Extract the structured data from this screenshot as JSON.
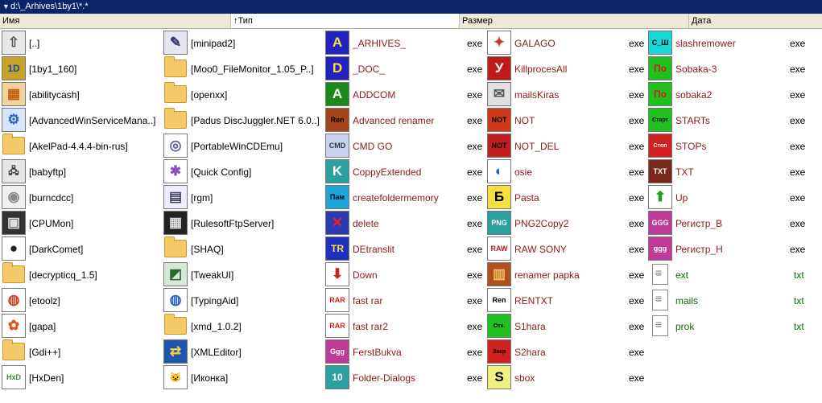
{
  "path": "d:\\_Arhives\\1by1\\*.*",
  "columns": {
    "name": "Имя",
    "type": "Тип",
    "size": "Размер",
    "date": "Дата"
  },
  "col1": [
    {
      "name": "[..]",
      "icon": "up-arrow-icon",
      "glyph": "⇧",
      "bg": "#e8e8e8",
      "fg": "#555"
    },
    {
      "name": "[1by1_160]",
      "icon": "app-1by1-icon",
      "glyph": "1D",
      "bg": "#c7a227",
      "fg": "#1a4aa0"
    },
    {
      "name": "[abilitycash]",
      "icon": "abilitycash-icon",
      "glyph": "▦",
      "bg": "#f4d29c",
      "fg": "#c06010"
    },
    {
      "name": "[AdvancedWinServiceMana..]",
      "icon": "service-gears-icon",
      "glyph": "⚙",
      "bg": "#d8e6fb",
      "fg": "#2a62c9"
    },
    {
      "name": "[AkelPad-4.4.4-bin-rus]",
      "icon": "folder-icon",
      "glyph": "",
      "bg": "folder",
      "fg": ""
    },
    {
      "name": "[babyftp]",
      "icon": "network-computers-icon",
      "glyph": "🖧",
      "bg": "#e6e6e6",
      "fg": "#333"
    },
    {
      "name": "[burncdcc]",
      "icon": "cd-disc-icon",
      "glyph": "◉",
      "bg": "#f0f0f0",
      "fg": "#888"
    },
    {
      "name": "[CPUMon]",
      "icon": "cpu-chip-icon",
      "glyph": "▣",
      "bg": "#333",
      "fg": "#ddd"
    },
    {
      "name": "[DarkComet]",
      "icon": "darkcomet-icon",
      "glyph": "●",
      "bg": "#fff",
      "fg": "#222"
    },
    {
      "name": "[decrypticq_1.5]",
      "icon": "folder-icon",
      "glyph": "",
      "bg": "folder",
      "fg": ""
    },
    {
      "name": "[etoolz]",
      "icon": "etoolz-globe-icon",
      "glyph": "◍",
      "bg": "#fff",
      "fg": "#d04020"
    },
    {
      "name": "[gapa]",
      "icon": "butterfly-icon",
      "glyph": "✿",
      "bg": "#fff",
      "fg": "#e05020"
    },
    {
      "name": "[Gdi++]",
      "icon": "folder-icon",
      "glyph": "",
      "bg": "folder",
      "fg": ""
    },
    {
      "name": "[HxDen]",
      "icon": "hxd-icon",
      "glyph": "HxD",
      "bg": "#fff",
      "fg": "#3a8a3a"
    }
  ],
  "col2": [
    {
      "name": "[minipad2]",
      "icon": "notepad-pen-icon",
      "glyph": "✎",
      "bg": "#e6e6f0",
      "fg": "#336"
    },
    {
      "name": "[Moo0_FileMonitor_1.05_P..]",
      "icon": "folder-icon",
      "glyph": "",
      "bg": "folder",
      "fg": ""
    },
    {
      "name": "[openxx]",
      "icon": "folder-icon",
      "glyph": "",
      "bg": "folder",
      "fg": ""
    },
    {
      "name": "[Padus DiscJuggler.NET 6.0..]",
      "icon": "folder-icon",
      "glyph": "",
      "bg": "folder",
      "fg": ""
    },
    {
      "name": "[PortableWinCDEmu]",
      "icon": "cd-emu-icon",
      "glyph": "◎",
      "bg": "#fff",
      "fg": "#5a5aa0"
    },
    {
      "name": "[Quick Config]",
      "icon": "quick-config-icon",
      "glyph": "✱",
      "bg": "#fff",
      "fg": "#8a50c0"
    },
    {
      "name": "[rgm]",
      "icon": "rgm-icon",
      "glyph": "▤",
      "bg": "#eef",
      "fg": "#446"
    },
    {
      "name": "[RulesoftFtpServer]",
      "icon": "ftp-server-icon",
      "glyph": "▦",
      "bg": "#222",
      "fg": "#ddd"
    },
    {
      "name": "[SHAQ]",
      "icon": "folder-icon",
      "glyph": "",
      "bg": "folder",
      "fg": ""
    },
    {
      "name": "[TweakUI]",
      "icon": "tweakui-icon",
      "glyph": "◩",
      "bg": "#d8e8d8",
      "fg": "#2a6a2a"
    },
    {
      "name": "[TypingAid]",
      "icon": "typingaid-globe-icon",
      "glyph": "◍",
      "bg": "#fff",
      "fg": "#2060c0"
    },
    {
      "name": "[xmd_1.0.2]",
      "icon": "folder-icon",
      "glyph": "",
      "bg": "folder",
      "fg": ""
    },
    {
      "name": "[XMLEditor]",
      "icon": "xml-editor-icon",
      "glyph": "⇄",
      "bg": "#1f56b0",
      "fg": "#f5d23a"
    },
    {
      "name": "[Иконка]",
      "icon": "cat-icon",
      "glyph": "😺",
      "bg": "#fff",
      "fg": "#333"
    }
  ],
  "col3": [
    {
      "name": "_ARHIVES_",
      "ext": "exe",
      "icon": "letter-a-icon",
      "glyph": "A",
      "bg": "#2222c0",
      "fg": "#f5e040"
    },
    {
      "name": "_DOC_",
      "ext": "exe",
      "icon": "letter-d-icon",
      "glyph": "D",
      "bg": "#2222c0",
      "fg": "#f5e040"
    },
    {
      "name": "ADDCOM",
      "ext": "exe",
      "icon": "addcom-icon",
      "glyph": "A",
      "bg": "#1a8a1a",
      "fg": "#fff"
    },
    {
      "name": "Advanced renamer",
      "ext": "exe",
      "icon": "ren-icon",
      "glyph": "Ren",
      "bg": "#a5431a",
      "fg": "#000"
    },
    {
      "name": "CMD GO",
      "ext": "exe",
      "icon": "cmd-icon",
      "glyph": "CMD",
      "bg": "#c8d2f0",
      "fg": "#334"
    },
    {
      "name": "CoppyExtended",
      "ext": "exe",
      "icon": "letter-k-icon",
      "glyph": "K",
      "bg": "#2aa0a0",
      "fg": "#fff"
    },
    {
      "name": "createfoldermemory",
      "ext": "exe",
      "icon": "folder-memory-icon",
      "glyph": "Пам",
      "bg": "#1aa6d6",
      "fg": "#002"
    },
    {
      "name": "delete",
      "ext": "exe",
      "icon": "delete-x-icon",
      "glyph": "✕",
      "bg": "#2a3ab0",
      "fg": "#f02020"
    },
    {
      "name": "DEtranslit",
      "ext": "exe",
      "icon": "tr-icon",
      "glyph": "TR",
      "bg": "#2030c0",
      "fg": "#f5e040"
    },
    {
      "name": "Down",
      "ext": "exe",
      "icon": "down-arrow-icon",
      "glyph": "⬇",
      "bg": "#fff",
      "fg": "#d02020"
    },
    {
      "name": "fast rar",
      "ext": "exe",
      "icon": "rar-icon",
      "glyph": "RAR",
      "bg": "#fff",
      "fg": "#d02020"
    },
    {
      "name": "fast rar2",
      "ext": "exe",
      "icon": "rar-slash-icon",
      "glyph": "RAR",
      "bg": "#fff",
      "fg": "#d02020"
    },
    {
      "name": "FerstBukva",
      "ext": "exe",
      "icon": "ggg-icon",
      "glyph": "Ggg",
      "bg": "#c03a9a",
      "fg": "#fff"
    },
    {
      "name": "Folder-Dialogs",
      "ext": "exe",
      "icon": "number-10-icon",
      "glyph": "10",
      "bg": "#2aa0a0",
      "fg": "#fff"
    }
  ],
  "col4": [
    {
      "name": "GALAGO",
      "ext": "exe",
      "icon": "galago-chest-icon",
      "glyph": "✦",
      "bg": "#fff",
      "fg": "#c83a1a"
    },
    {
      "name": "KillprocesAll",
      "ext": "exe",
      "icon": "letter-u-icon",
      "glyph": "У",
      "bg": "#c01a1a",
      "fg": "#fff"
    },
    {
      "name": "mailsKiras",
      "ext": "exe",
      "icon": "envelope-icon",
      "glyph": "✉",
      "bg": "#e0e0e0",
      "fg": "#555"
    },
    {
      "name": "NOT",
      "ext": "exe",
      "icon": "not-icon",
      "glyph": "NOT",
      "bg": "#d03a1a",
      "fg": "#000"
    },
    {
      "name": "NOT_DEL",
      "ext": "exe",
      "icon": "not-del-icon",
      "glyph": "NOT",
      "bg": "#c02020",
      "fg": "#000"
    },
    {
      "name": "osie",
      "ext": "exe",
      "icon": "osie-folder-icon",
      "glyph": "◐",
      "bg": "#fff",
      "fg": "#2060c0"
    },
    {
      "name": "Pasta",
      "ext": "exe",
      "icon": "letter-b-shield-icon",
      "glyph": "Б",
      "bg": "#f5e040",
      "fg": "#000"
    },
    {
      "name": "PNG2Copy2",
      "ext": "exe",
      "icon": "png-icon",
      "glyph": "PNG",
      "bg": "#2aa0a0",
      "fg": "#fff"
    },
    {
      "name": "RAW SONY",
      "ext": "exe",
      "icon": "raw-arw-icon",
      "glyph": "RAW",
      "bg": "#fff",
      "fg": "#b02020"
    },
    {
      "name": "renamer papka",
      "ext": "exe",
      "icon": "renamer-folder-icon",
      "glyph": "▥",
      "bg": "#b05020",
      "fg": "#f0c060"
    },
    {
      "name": "RENTXT",
      "ext": "exe",
      "icon": "ren-txt-icon",
      "glyph": "Ren",
      "bg": "#fff",
      "fg": "#000"
    },
    {
      "name": "S1hara",
      "ext": "exe",
      "icon": "otk-icon",
      "glyph": "Отк.",
      "bg": "#20c020",
      "fg": "#000"
    },
    {
      "name": "S2hara",
      "ext": "exe",
      "icon": "zakr-icon",
      "glyph": "Закр",
      "bg": "#d02020",
      "fg": "#000"
    },
    {
      "name": "sbox",
      "ext": "exe",
      "icon": "s-box-icon",
      "glyph": "S",
      "bg": "#f0f080",
      "fg": "#000"
    }
  ],
  "col5": [
    {
      "name": "slashremower",
      "ext": "exe",
      "icon": "c-sh-icon",
      "glyph": "C_Ш",
      "bg": "#1ad6d6",
      "fg": "#000"
    },
    {
      "name": "Sobaka-3",
      "ext": "exe",
      "icon": "pochta-icon",
      "glyph": "По",
      "bg": "#20c020",
      "fg": "#d02020"
    },
    {
      "name": "sobaka2",
      "ext": "exe",
      "icon": "pochta-icon",
      "glyph": "По",
      "bg": "#20c020",
      "fg": "#d02020"
    },
    {
      "name": "STARTs",
      "ext": "exe",
      "icon": "start-service-icon",
      "glyph": "Старт",
      "bg": "#20c020",
      "fg": "#000"
    },
    {
      "name": "STOPs",
      "ext": "exe",
      "icon": "stop-service-icon",
      "glyph": "Стоп",
      "bg": "#d02020",
      "fg": "#fff"
    },
    {
      "name": "TXT",
      "ext": "exe",
      "icon": "txt-icon",
      "glyph": "TXT",
      "bg": "#7a2a1a",
      "fg": "#fff"
    },
    {
      "name": "Up",
      "ext": "exe",
      "icon": "up-green-arrow-icon",
      "glyph": "⬆",
      "bg": "#fff",
      "fg": "#1aa01a"
    },
    {
      "name": "Регистр_B",
      "ext": "exe",
      "icon": "ggg-upper-icon",
      "glyph": "GGG",
      "bg": "#c03a9a",
      "fg": "#fff"
    },
    {
      "name": "Регистр_H",
      "ext": "exe",
      "icon": "ggg-lower-icon",
      "glyph": "ggg",
      "bg": "#c03a9a",
      "fg": "#fff"
    },
    {
      "name": "ext",
      "ext": "txt",
      "icon": "text-file-icon",
      "glyph": "",
      "bg": "doc",
      "fg": ""
    },
    {
      "name": "mails",
      "ext": "txt",
      "icon": "text-file-icon",
      "glyph": "",
      "bg": "doc",
      "fg": ""
    },
    {
      "name": "prok",
      "ext": "txt",
      "icon": "text-file-icon",
      "glyph": "",
      "bg": "doc",
      "fg": ""
    }
  ]
}
